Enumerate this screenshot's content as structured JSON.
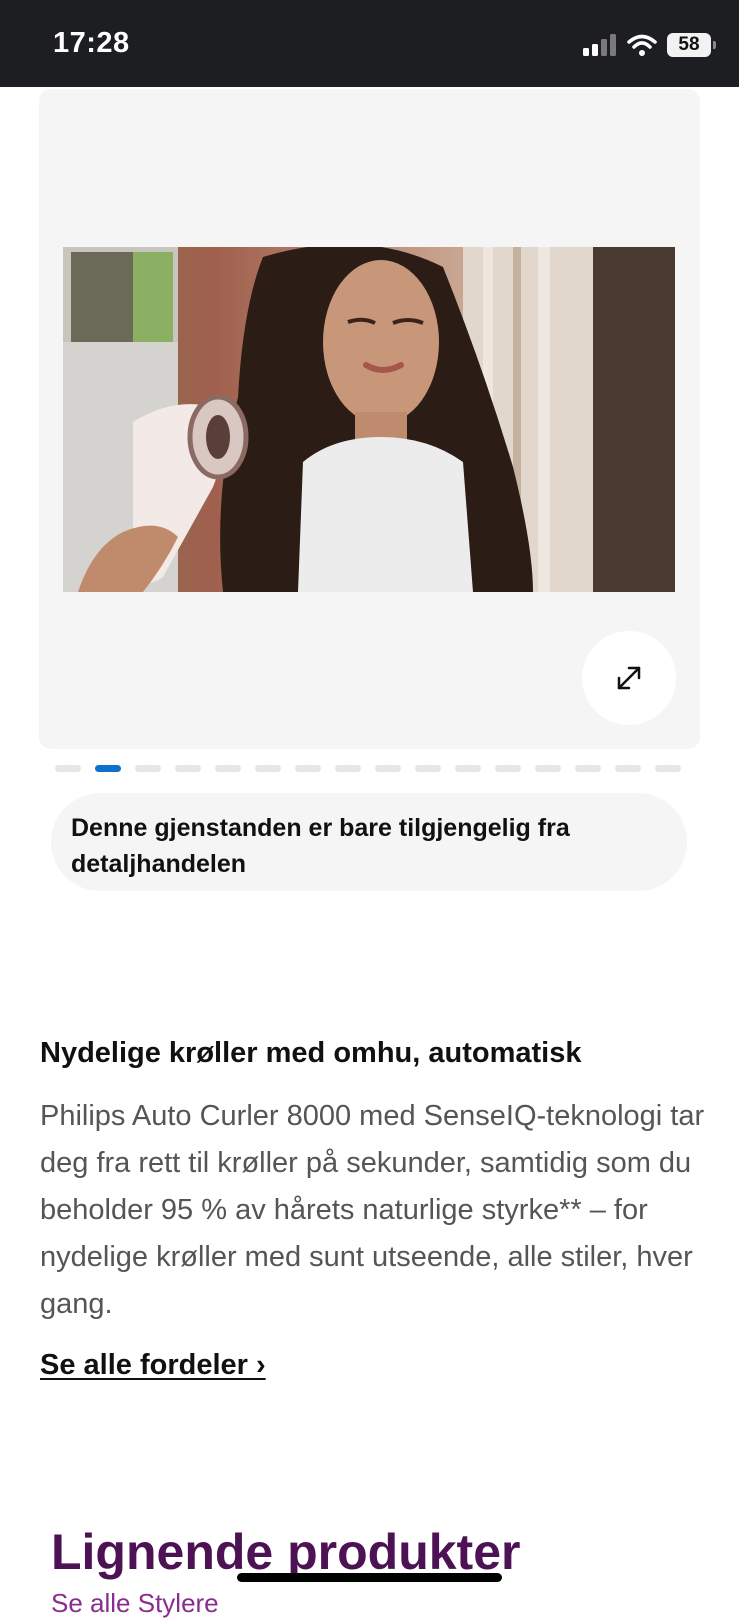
{
  "status_bar": {
    "time": "17:28",
    "battery": "58",
    "icons": [
      "signal-icon",
      "wifi-icon",
      "battery-icon"
    ]
  },
  "gallery": {
    "image_alt": "Woman with long dark curly hair holding Philips Auto Curler",
    "expand_icon": "expand-arrows-icon",
    "dots_count": 16,
    "active_dot": 1,
    "accent_color": "#0b73cc"
  },
  "availability_note": "Denne gjenstanden er bare tilgjengelig fra detaljhandelen",
  "feature": {
    "title": "Nydelige krøller med omhu, automatisk",
    "description": "Philips Auto Curler 8000 med SenseIQ-teknologi tar deg fra rett til krøller på sekunder, samtidig som du beholder 95 % av hårets naturlige styrke** – for nydelige krøller med sunt utseende, alle stiler, hver gang.",
    "see_all_link": "Se alle fordeler ›"
  },
  "similar": {
    "title": "Lignende produkter",
    "link": "Se alle Stylere"
  }
}
